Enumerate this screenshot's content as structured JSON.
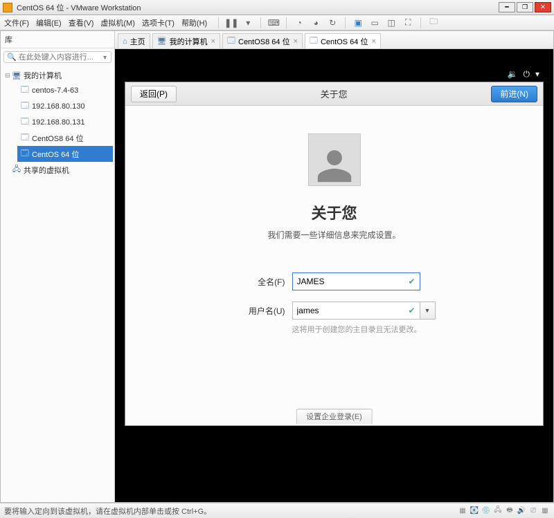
{
  "window": {
    "title": "CentOS 64 位 - VMware Workstation"
  },
  "menubar": {
    "items": [
      "文件(F)",
      "编辑(E)",
      "查看(V)",
      "虚拟机(M)",
      "选项卡(T)",
      "帮助(H)"
    ]
  },
  "sidebar": {
    "header": "库",
    "search_placeholder": "在此处键入内容进行...",
    "root": "我的计算机",
    "vms": [
      "centos-7.4-63",
      "192.168.80.130",
      "192.168.80.131",
      "CentOS8 64 位",
      "CentOS 64 位"
    ],
    "shared": "共享的虚拟机",
    "selected_index": 4
  },
  "tabs": [
    {
      "label": "主页",
      "icon": "home"
    },
    {
      "label": "我的计算机",
      "icon": "pc"
    },
    {
      "label": "CentOS8 64 位",
      "icon": "vm"
    },
    {
      "label": "CentOS 64 位",
      "icon": "vm",
      "active": true
    }
  ],
  "guest": {
    "back": "返回(P)",
    "next": "前进(N)",
    "header_title": "关于您",
    "h1": "关于您",
    "subtitle": "我们需要一些详细信息来完成设置。",
    "fullname_label": "全名(F)",
    "fullname_value": "JAMES",
    "username_label": "用户名(U)",
    "username_value": "james",
    "username_hint": "这将用于创建您的主目录且无法更改。",
    "enterprise": "设置企业登录(E)"
  },
  "statusbar": {
    "hint": "要将输入定向到该虚拟机，请在虚拟机内部单击或按 Ctrl+G。"
  }
}
